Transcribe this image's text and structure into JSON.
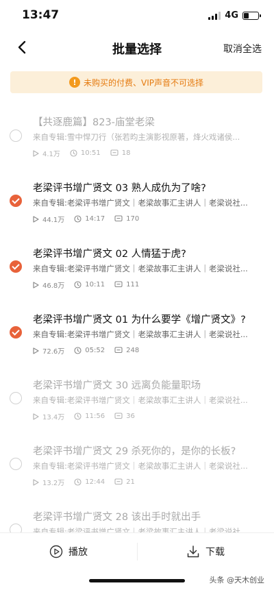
{
  "status_bar": {
    "time": "13:47",
    "network": "4G"
  },
  "nav": {
    "title": "批量选择",
    "cancel_all": "取消全选"
  },
  "notice": {
    "icon": "!",
    "text": "未购买的付费、VIP声音不可选择"
  },
  "items": [
    {
      "title": "【共逐鹿篇】823-庙堂老梁",
      "subtitle": "来自专辑:雪中悍刀行（张若昀主演影视原著，烽火戏诸侯...",
      "plays": "4.1万",
      "duration": "10:51",
      "comments": "18",
      "checked": false,
      "disabled": true
    },
    {
      "title": "老梁评书增广贤文 03 熟人成仇为了啥?",
      "subtitle": "来自专辑:老梁评书增广贤文｜老梁故事汇主讲人｜老梁说社...",
      "plays": "44.1万",
      "duration": "14:17",
      "comments": "170",
      "checked": true,
      "disabled": false
    },
    {
      "title": "老梁评书增广贤文 02 人情猛于虎?",
      "subtitle": "来自专辑:老梁评书增广贤文｜老梁故事汇主讲人｜老梁说社...",
      "plays": "46.8万",
      "duration": "10:11",
      "comments": "111",
      "checked": true,
      "disabled": false
    },
    {
      "title": "老梁评书增广贤文 01 为什么要学《增广贤文》?",
      "subtitle": "来自专辑:老梁评书增广贤文｜老梁故事汇主讲人｜老梁说社...",
      "plays": "72.6万",
      "duration": "05:52",
      "comments": "248",
      "checked": true,
      "disabled": false
    },
    {
      "title": "老梁评书增广贤文 30 远离负能量职场",
      "subtitle": "来自专辑:老梁评书增广贤文｜老梁故事汇主讲人｜老梁说社...",
      "plays": "13.4万",
      "duration": "11:56",
      "comments": "36",
      "checked": false,
      "disabled": true
    },
    {
      "title": "老梁评书增广贤文 29 杀死你的，是你的长板?",
      "subtitle": "来自专辑:老梁评书增广贤文｜老梁故事汇主讲人｜老梁说社...",
      "plays": "13.2万",
      "duration": "12:44",
      "comments": "21",
      "checked": false,
      "disabled": true
    },
    {
      "title": "老梁评书增广贤文 28 该出手时就出手",
      "subtitle": "来自专辑:老梁评书增广贤文｜老梁故事汇主讲人｜老梁说社...",
      "plays": "",
      "duration": "",
      "comments": "",
      "checked": false,
      "disabled": true
    }
  ],
  "bottom": {
    "play_label": "播放",
    "download_label": "下载"
  },
  "watermark": "头条 @天木创业",
  "colors": {
    "accent": "#e8623a",
    "notice_bg": "#fcefd9",
    "notice_text": "#e57a0f"
  }
}
